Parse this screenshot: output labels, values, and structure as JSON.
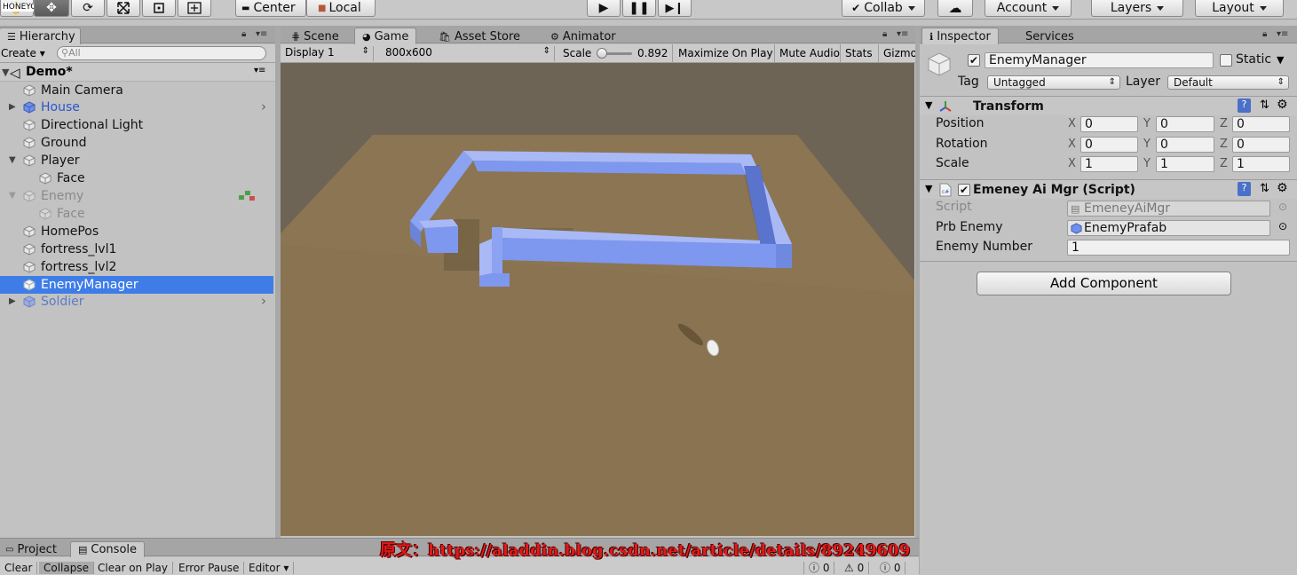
{
  "app": {
    "watermark_corner": "HONEYCAM"
  },
  "toolbar": {
    "pivot_label": "Center",
    "space_label": "Local",
    "collab_label": "Collab",
    "account_label": "Account",
    "layers_label": "Layers",
    "layout_label": "Layout"
  },
  "hierarchy": {
    "tab_label": "Hierarchy",
    "create_label": "Create",
    "search_placeholder": "All",
    "scene_name": "Demo*",
    "items": [
      {
        "label": "Main Camera"
      },
      {
        "label": "House"
      },
      {
        "label": "Directional Light"
      },
      {
        "label": "Ground"
      },
      {
        "label": "Player"
      },
      {
        "label": "Face"
      },
      {
        "label": "Enemy"
      },
      {
        "label": "Face"
      },
      {
        "label": "HomePos"
      },
      {
        "label": "fortress_lvl1"
      },
      {
        "label": "fortress_lvl2"
      },
      {
        "label": "EnemyManager"
      },
      {
        "label": "Soldier"
      }
    ]
  },
  "center": {
    "tabs": [
      {
        "label": "Scene"
      },
      {
        "label": "Game"
      },
      {
        "label": "Asset Store"
      },
      {
        "label": "Animator"
      }
    ],
    "display_label": "Display 1",
    "resolution_label": "800x600",
    "scale_label": "Scale",
    "scale_value": "0.892",
    "scale_fraction": 0.15,
    "maximize_label": "Maximize On Play",
    "mute_label": "Mute Audio",
    "stats_label": "Stats",
    "gizmos_label": "Gizmo"
  },
  "inspector": {
    "tabs": [
      {
        "label": "Inspector"
      },
      {
        "label": "Services"
      }
    ],
    "object_name": "EnemyManager",
    "static_label": "Static",
    "tag_label": "Tag",
    "tag_value": "Untagged",
    "layer_label": "Layer",
    "layer_value": "Default",
    "transform": {
      "title": "Transform",
      "position_label": "Position",
      "rotation_label": "Rotation",
      "scale_label": "Scale",
      "axis_x": "X",
      "axis_y": "Y",
      "axis_z": "Z",
      "position": [
        "0",
        "0",
        "0"
      ],
      "rotation": [
        "0",
        "0",
        "0"
      ],
      "scale": [
        "1",
        "1",
        "1"
      ]
    },
    "script_component": {
      "title": "Emeney Ai Mgr (Script)",
      "script_label": "Script",
      "script_value": "EmeneyAiMgr",
      "prb_label": "Prb Enemy",
      "prb_value": "EnemyPrafab",
      "number_label": "Enemy Number",
      "number_value": "1"
    },
    "add_component_label": "Add Component"
  },
  "bottom": {
    "tabs": [
      {
        "label": "Project"
      },
      {
        "label": "Console"
      }
    ],
    "buttons": [
      {
        "label": "Clear"
      },
      {
        "label": "Collapse"
      },
      {
        "label": "Clear on Play"
      },
      {
        "label": "Error Pause"
      },
      {
        "label": "Editor"
      }
    ],
    "counts": {
      "logs": "0",
      "warnings": "0",
      "errors": "0"
    }
  },
  "watermark": "原文：https://aladdin.blog.csdn.net/article/details/89249609",
  "colors": {
    "selection": "#3e7de8",
    "accent_blue": "#2b56c9",
    "wall_blue": "#7e97ef"
  }
}
